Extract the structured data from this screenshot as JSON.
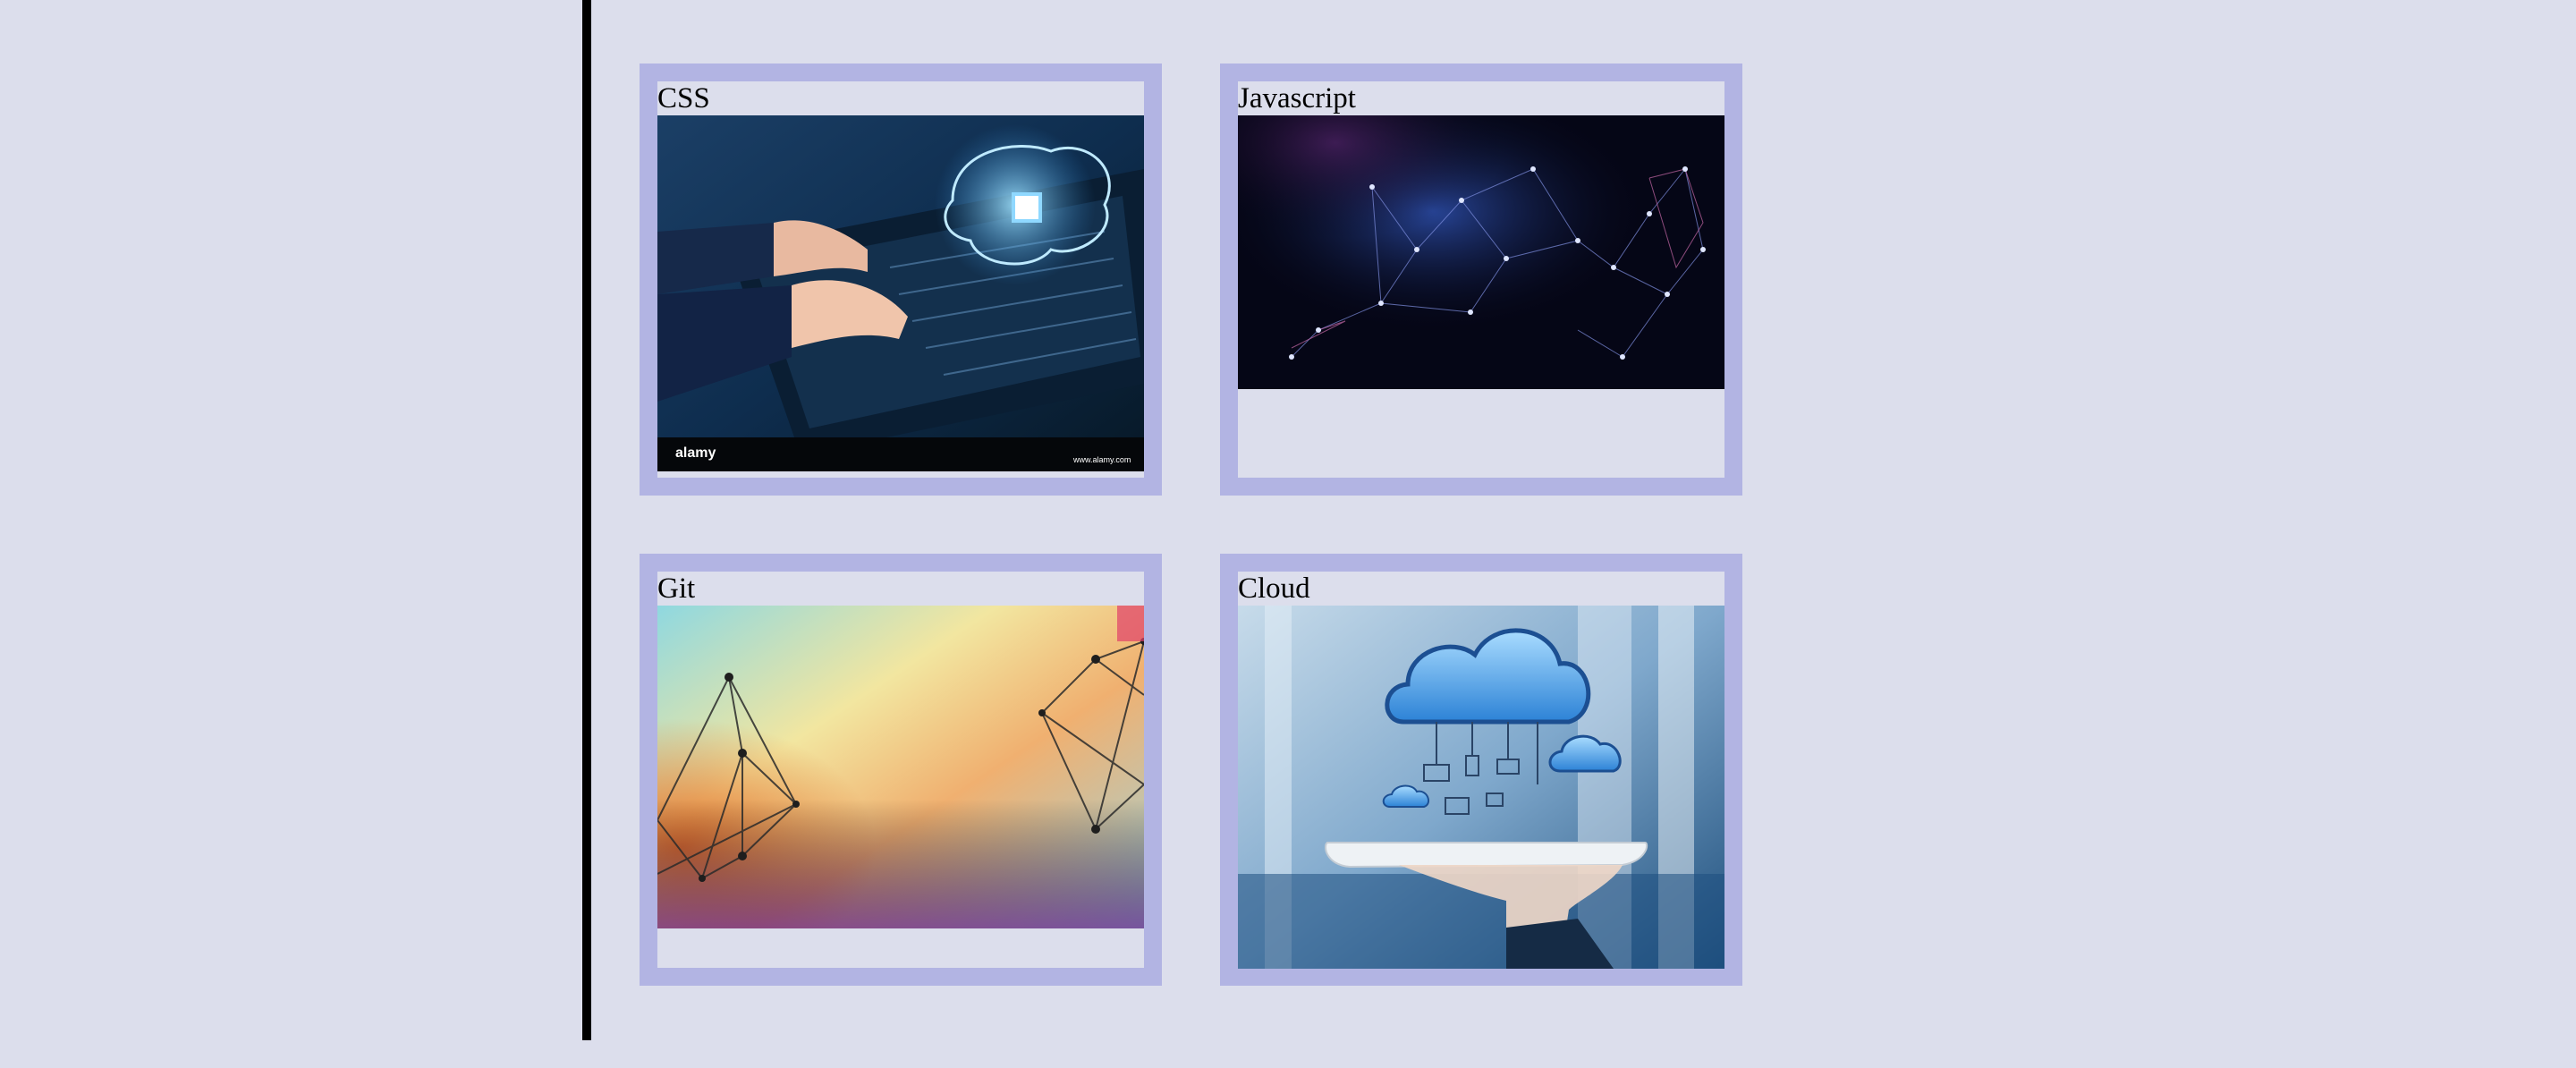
{
  "cards": [
    {
      "title": "CSS",
      "image_watermark": "alamy",
      "image_caption": "www.alamy.com"
    },
    {
      "title": "Javascript"
    },
    {
      "title": "Git"
    },
    {
      "title": "Cloud"
    }
  ],
  "colors": {
    "background": "#dcdeec",
    "card_border": "#b2b4e3",
    "divider": "#000000"
  }
}
